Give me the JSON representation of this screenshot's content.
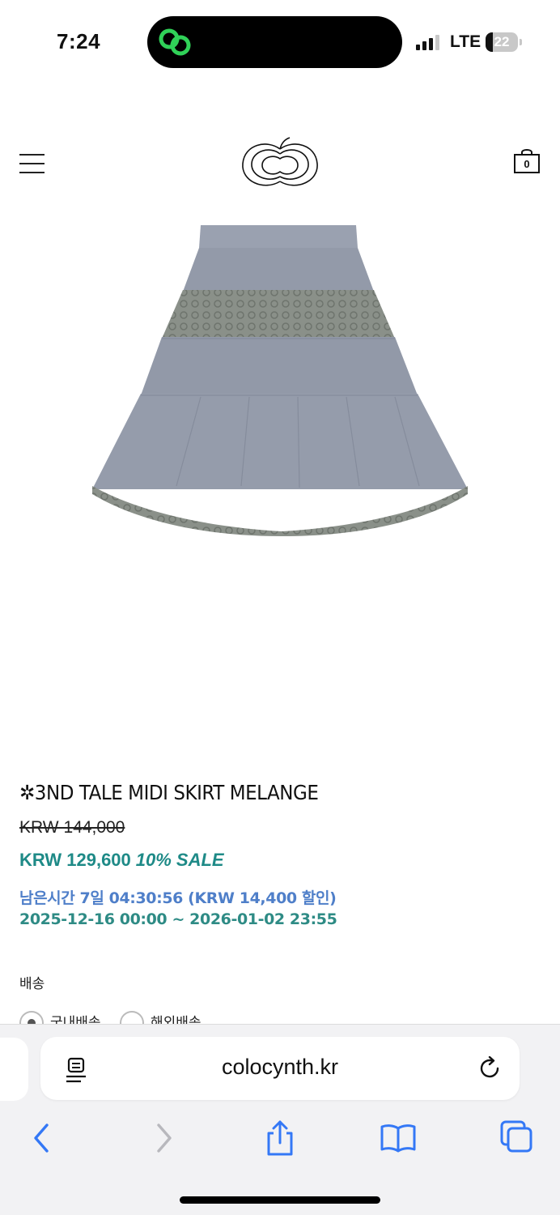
{
  "status_bar": {
    "time": "7:24",
    "network": "LTE",
    "battery_level": "22",
    "battery_fraction": 0.22,
    "signal_bars": 3
  },
  "header": {
    "cart_count": "0"
  },
  "product": {
    "name": "✲3ND TALE MIDI SKIRT MELANGE",
    "original_price": "KRW 144,000",
    "sale_price": "KRW 129,600",
    "sale_label": "10% SALE",
    "time_left": "남은시간 7일 04:30:56 (KRW 14,400 할인)",
    "sale_period": "2025-12-16 00:00 ~ 2026-01-02 23:55",
    "shipping_label": "배송",
    "shipping_options": [
      {
        "label": "국내배송",
        "selected": true
      },
      {
        "label": "해외배송",
        "selected": false
      }
    ]
  },
  "browser": {
    "url": "colocynth.kr"
  },
  "colors": {
    "sale_teal": "#1e8a87",
    "timer_blue": "#4f7fc9",
    "safari_blue": "#3478f6",
    "island_green": "#30d158"
  }
}
